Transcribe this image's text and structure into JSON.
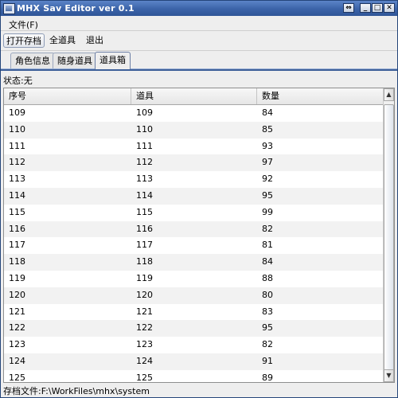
{
  "window": {
    "title": "MHX Sav Editor ver 0.1",
    "controls": {
      "move": "⇔",
      "minimize": "_",
      "maximize": "□",
      "close": "✕"
    }
  },
  "menubar": {
    "file": "文件(F)"
  },
  "toolbar": {
    "open_label": "打开存档",
    "all_items_label": "全道具",
    "exit_label": "退出"
  },
  "tabs": [
    {
      "label": "角色信息"
    },
    {
      "label": "随身道具"
    },
    {
      "label": "道具箱"
    }
  ],
  "status": "状态:无",
  "table": {
    "columns": [
      "序号",
      "道具",
      "数量"
    ],
    "rows": [
      [
        "109",
        "109",
        "84"
      ],
      [
        "110",
        "110",
        "85"
      ],
      [
        "111",
        "111",
        "93"
      ],
      [
        "112",
        "112",
        "97"
      ],
      [
        "113",
        "113",
        "92"
      ],
      [
        "114",
        "114",
        "95"
      ],
      [
        "115",
        "115",
        "99"
      ],
      [
        "116",
        "116",
        "82"
      ],
      [
        "117",
        "117",
        "81"
      ],
      [
        "118",
        "118",
        "84"
      ],
      [
        "119",
        "119",
        "88"
      ],
      [
        "120",
        "120",
        "80"
      ],
      [
        "121",
        "121",
        "83"
      ],
      [
        "122",
        "122",
        "95"
      ],
      [
        "123",
        "123",
        "82"
      ],
      [
        "124",
        "124",
        "91"
      ],
      [
        "125",
        "125",
        "89"
      ]
    ]
  },
  "footer": "存档文件:F:\\WorkFiles\\mhx\\system",
  "colors": {
    "titlebar": "#3b63a8",
    "tab_accent": "#3d5f99"
  }
}
